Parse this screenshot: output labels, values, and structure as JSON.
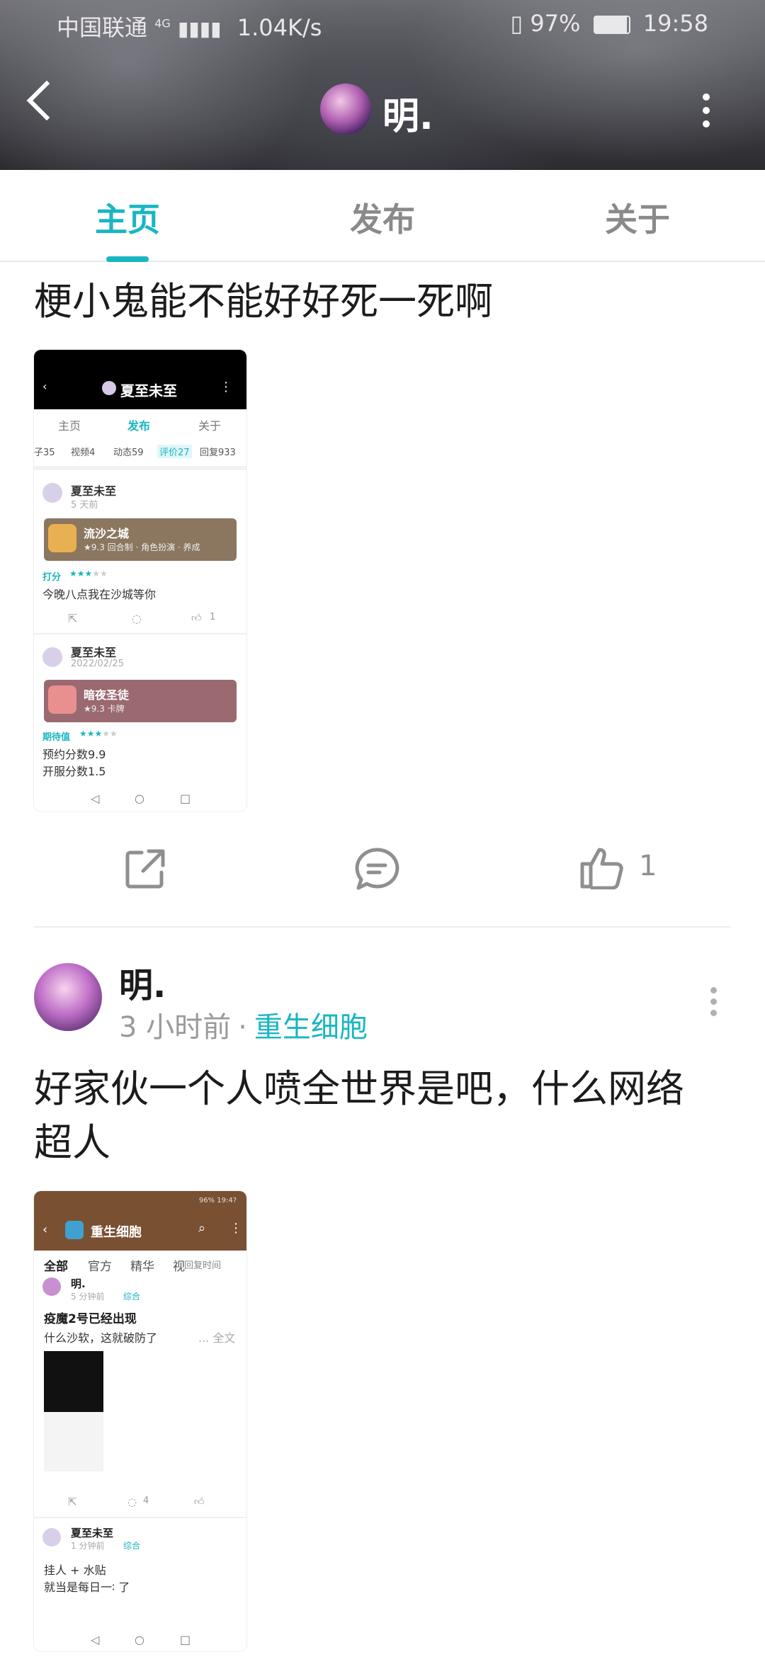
{
  "status_bar": {
    "carrier": "中国联通",
    "network": "4G",
    "speed": "1.04K/s",
    "battery": "97%",
    "time": "19:58"
  },
  "nav": {
    "username": "明."
  },
  "tabs": [
    {
      "label": "主页"
    },
    {
      "label": "发布"
    },
    {
      "label": "关于"
    }
  ],
  "post1": {
    "text": "梗小鬼能不能好好死一死啊",
    "likes": "1",
    "shot": {
      "title": "夏至未至",
      "tabs": [
        "主页",
        "发布",
        "关于"
      ],
      "subtabs": [
        "子35",
        "视频4",
        "动态59",
        "评价27",
        "回复933"
      ],
      "review1": {
        "user": "夏至未至",
        "time": "5 天前",
        "game": "流沙之城",
        "game_meta": "★9.3  回合制 · 角色扮演 · 养成",
        "score_label": "打分",
        "body": "今晚八点我在沙城等你",
        "likes": "1"
      },
      "review2": {
        "user": "夏至未至",
        "time": "2022/02/25",
        "game": "暗夜圣徒",
        "game_meta": "★9.3  卡牌",
        "score_label": "期待值",
        "body1": "预约分数9.9",
        "body2": "开服分数1.5"
      }
    }
  },
  "post2": {
    "user": "明.",
    "time": "3 小时前",
    "topic": "重生细胞",
    "text_line1": "好家伙一个人喷全世界是吧，什么网络",
    "text_line2": "超人",
    "shot": {
      "status": "96% 19:4?",
      "title": "重生细胞",
      "tabs": [
        "全部",
        "官方",
        "精华",
        "视"
      ],
      "sort": "回复时间",
      "p1_user": "明.",
      "p1_time": "5 分钟前",
      "p1_tag": "综合",
      "p1_title": "疫魔2号已经出现",
      "p1_body": "什么沙软，这就破防了",
      "p1_more": "... 全文",
      "p1_comments": "4",
      "p2_user": "夏至未至",
      "p2_time": "1 分钟前",
      "p2_tag": "综合",
      "p2_body1": "挂人 + 水贴",
      "p2_body2": "就当是每日一∶ 了"
    }
  },
  "colors": {
    "accent": "#19b6c2",
    "muted": "#9a9a9a"
  }
}
